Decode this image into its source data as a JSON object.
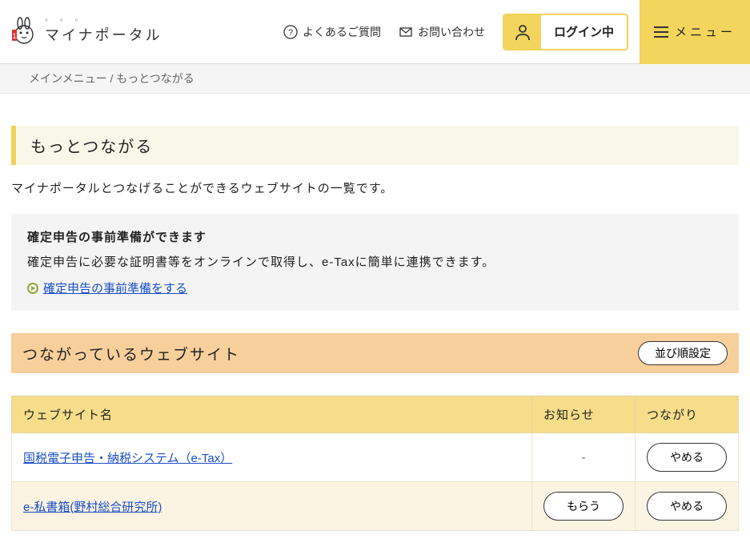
{
  "header": {
    "site_name": "マイナポータル",
    "nav": {
      "faq": "よくあるご質問",
      "contact": "お問い合わせ"
    },
    "login_status": "ログイン中",
    "menu": "メニュー"
  },
  "breadcrumb": {
    "root": "メインメニュー",
    "sep": " / ",
    "current": "もっとつながる"
  },
  "page": {
    "title": "もっとつながる",
    "intro": "マイナポータルとつなげることができるウェブサイトの一覧です。"
  },
  "notice": {
    "title": "確定申告の事前準備ができます",
    "desc": "確定申告に必要な証明書等をオンラインで取得し、e-Taxに簡単に連携できます。",
    "link": "確定申告の事前準備をする"
  },
  "section": {
    "title": "つながっているウェブサイト",
    "sort_btn": "並び順設定"
  },
  "table": {
    "headers": {
      "website": "ウェブサイト名",
      "notice": "お知らせ",
      "connect": "つながり"
    },
    "rows": [
      {
        "site": "国税電子申告・納税システム（e-Tax）",
        "notice_action": "-",
        "connect_action": "やめる"
      },
      {
        "site": "e-私書箱(野村総合研究所)",
        "notice_action": "もらう",
        "connect_action": "やめる"
      }
    ]
  }
}
